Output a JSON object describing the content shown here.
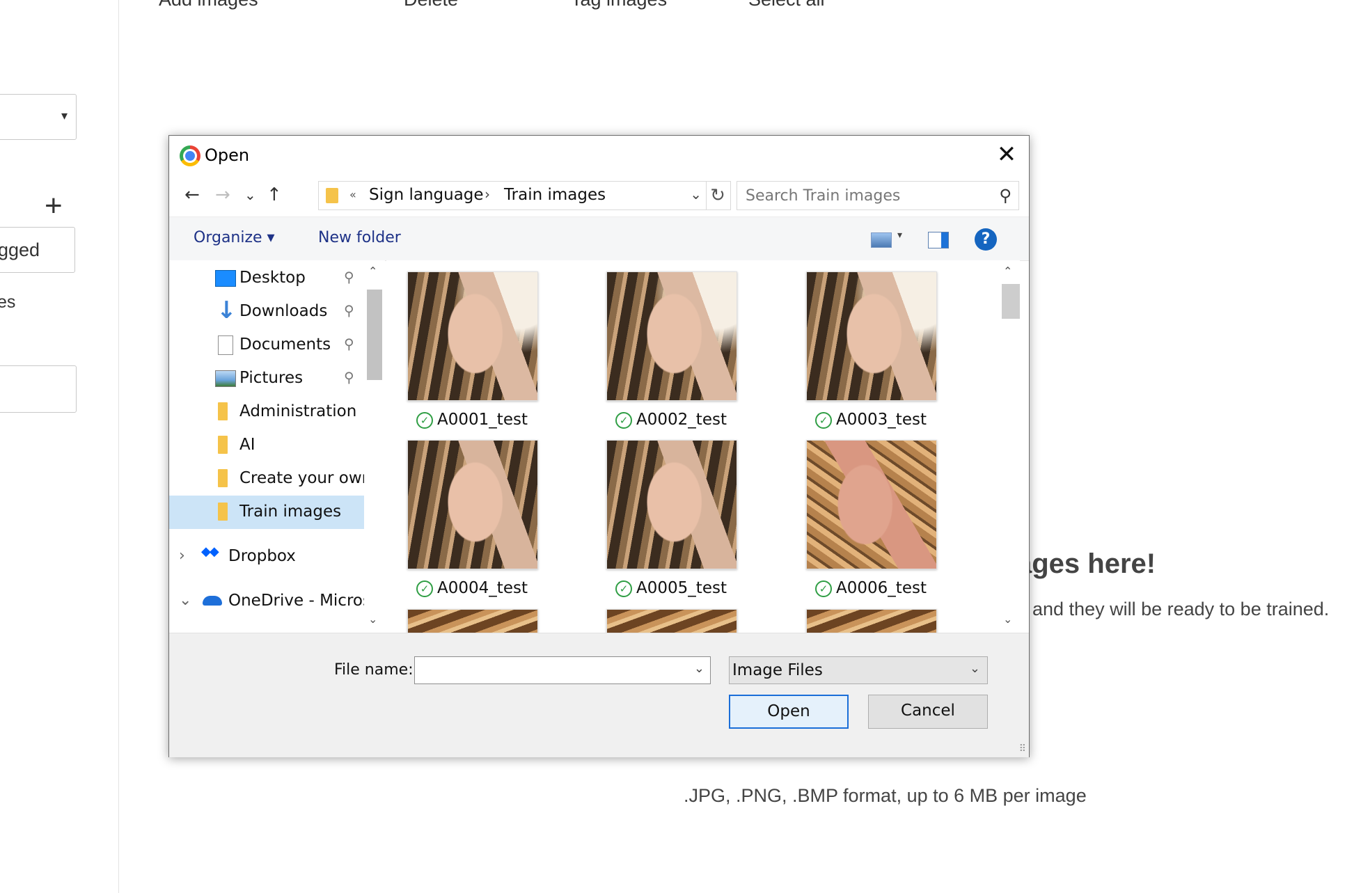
{
  "background": {
    "toolbar": {
      "add_images": "Add images",
      "delete": "Delete",
      "tag_images": "Tag images",
      "select_all": "Select all"
    },
    "left": {
      "dropdown_caret": "▾",
      "plus": "+",
      "tagged_text": "gged",
      "es_text": "es"
    },
    "upload_heading": "ages here!",
    "upload_sub": "and they will be ready to be trained.",
    "format_note": ".JPG, .PNG, .BMP format, up to 6 MB per image"
  },
  "dialog": {
    "title": "Open",
    "close_glyph": "✕",
    "nav": {
      "back": "←",
      "forward": "→",
      "recent": "⌄",
      "up": "↑"
    },
    "breadcrumb": {
      "overflow": "«",
      "separator": "›",
      "items": [
        "Sign language",
        "Train images"
      ],
      "dropdown": "⌄"
    },
    "refresh_glyph": "↻",
    "search": {
      "placeholder": "Search Train images",
      "icon": "⚲"
    },
    "commands": {
      "organize": "Organize ▾",
      "new_folder": "New folder",
      "view_caret": "▾",
      "help": "?"
    },
    "tree": [
      {
        "label": "Desktop",
        "icon": "desktop-icon",
        "pinned": true
      },
      {
        "label": "Downloads",
        "icon": "downloads-icon",
        "pinned": true
      },
      {
        "label": "Documents",
        "icon": "documents-icon",
        "pinned": true
      },
      {
        "label": "Pictures",
        "icon": "pictures-icon",
        "pinned": true
      },
      {
        "label": "Administration",
        "icon": "folder-icon",
        "pinned": false
      },
      {
        "label": "AI",
        "icon": "folder-icon",
        "pinned": false
      },
      {
        "label": "Create your own",
        "icon": "folder-icon",
        "pinned": false
      },
      {
        "label": "Train images",
        "icon": "folder-icon",
        "pinned": false,
        "selected": true
      },
      {
        "label": "Dropbox",
        "icon": "dropbox-icon",
        "expander": "›"
      },
      {
        "label": "OneDrive - Micros",
        "icon": "onedrive-icon",
        "expander": "⌄"
      }
    ],
    "pin_glyph": "📌",
    "scroll": {
      "up": "⌃",
      "down": "⌄"
    },
    "files": [
      {
        "name": "A0001_test",
        "status": "synced"
      },
      {
        "name": "A0002_test",
        "status": "synced"
      },
      {
        "name": "A0003_test",
        "status": "synced"
      },
      {
        "name": "A0004_test",
        "status": "synced"
      },
      {
        "name": "A0005_test",
        "status": "synced"
      },
      {
        "name": "A0006_test",
        "status": "synced"
      }
    ],
    "check_glyph": "✓",
    "footer": {
      "file_name_label": "File name:",
      "file_name_value": "",
      "file_name_dd": "⌄",
      "file_type": "Image Files",
      "file_type_dd": "⌄",
      "open_label": "Open",
      "cancel_label": "Cancel",
      "grip": "⠿"
    }
  },
  "colors": {
    "accent": "#1a6ed8",
    "selected_bg": "#cce4f7",
    "link": "#1e3287",
    "synced_green": "#2f9e44"
  }
}
